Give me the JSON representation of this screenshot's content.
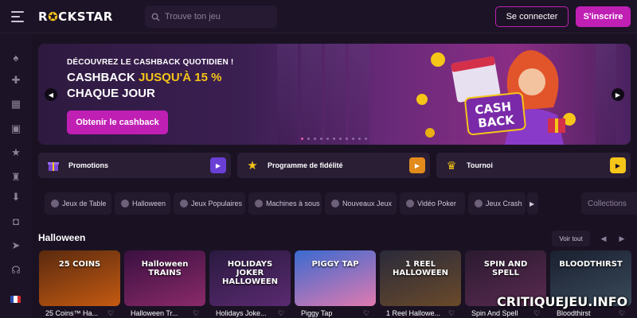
{
  "header": {
    "logo_text_before": "R",
    "logo_text_after": "CKSTAR",
    "search_placeholder": "Trouve ton jeu",
    "login_label": "Se connecter",
    "signup_label": "S'inscrire"
  },
  "sidebar": {
    "items": [
      "poker-icon",
      "puzzle-icon",
      "grid-icon",
      "gift-icon",
      "star-icon",
      "trophy-icon",
      "download-icon",
      "chip-icon",
      "telegram-icon",
      "headset-icon",
      "flag-fr-icon"
    ]
  },
  "hero": {
    "subtitle": "DÉCOUVREZ LE CASHBACK QUOTIDIEN !",
    "title_part1": "CASHBACK ",
    "title_highlight": "JUSQU'À 15 %",
    "title_line2": "CHAQUE JOUR",
    "cta_label": "Obtenir le cashback",
    "badge_line1": "CASH",
    "badge_line2": "BACK"
  },
  "features": [
    {
      "label": "Promotions",
      "accent": "#6a3fd6"
    },
    {
      "label": "Programme de fidélité",
      "accent": "#e28a1c"
    },
    {
      "label": "Tournoi",
      "accent": "#f5c518"
    }
  ],
  "categories": [
    "Jeux de Table",
    "Halloween",
    "Jeux Populaires",
    "Machines à sous",
    "Nouveaux Jeux",
    "Vidéo Poker",
    "Jeux Crash"
  ],
  "collections_label": "Collections",
  "section": {
    "title": "Halloween",
    "see_all": "Voir tout"
  },
  "games": [
    {
      "name": "25 Coins™ Ha...",
      "art_text": "25 COINS",
      "color1": "#5a2a0e",
      "color2": "#c45a12"
    },
    {
      "name": "Halloween Tr...",
      "art_text": "Halloween TRAINS",
      "color1": "#3a1040",
      "color2": "#8a2a6a"
    },
    {
      "name": "Holidays Joke...",
      "art_text": "HOLIDAYS JOKER HALLOWEEN",
      "color1": "#2a1a40",
      "color2": "#5a2a70"
    },
    {
      "name": "Piggy Tap",
      "art_text": "PIGGY TAP",
      "color1": "#3a6ad0",
      "color2": "#e07ab0"
    },
    {
      "name": "1 Reel Hallowe...",
      "art_text": "1 REEL HALLOWEEN",
      "color1": "#2a2a3a",
      "color2": "#6a4a2a"
    },
    {
      "name": "Spin And Spell",
      "art_text": "SPIN AND SPELL",
      "color1": "#2a1a30",
      "color2": "#5a2a50"
    },
    {
      "name": "Bloodthirst",
      "art_text": "BLOODTHIRST",
      "color1": "#1a2030",
      "color2": "#3a4a5a"
    }
  ],
  "watermark": "CRITIQUEJEU.INFO",
  "colors": {
    "accent": "#c01fb4",
    "highlight": "#f5c518",
    "background": "#1a1223"
  }
}
